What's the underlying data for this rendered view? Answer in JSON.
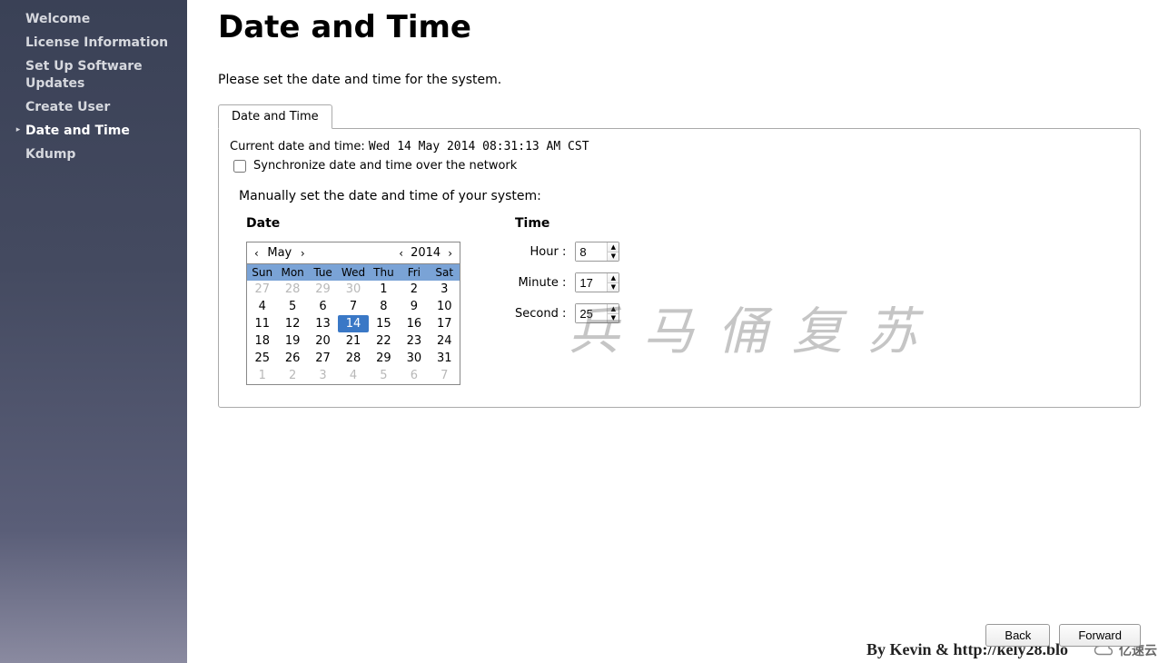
{
  "sidebar": {
    "items": [
      {
        "label": "Welcome",
        "current": false
      },
      {
        "label": "License Information",
        "current": false
      },
      {
        "label": "Set Up Software Updates",
        "current": false
      },
      {
        "label": "Create User",
        "current": false
      },
      {
        "label": "Date and Time",
        "current": true
      },
      {
        "label": "Kdump",
        "current": false
      }
    ]
  },
  "page": {
    "title": "Date and Time",
    "description": "Please set the date and time for the system."
  },
  "tab": {
    "label": "Date and Time"
  },
  "current_dt": {
    "label": "Current date and time:  ",
    "value": "Wed 14 May 2014 08:31:13 AM CST"
  },
  "sync": {
    "checked": false,
    "label": "Synchronize date and time over the network"
  },
  "manual": {
    "label": "Manually set the date and time of your system:"
  },
  "date": {
    "heading": "Date",
    "month": "May",
    "year": "2014",
    "dow": [
      "Sun",
      "Mon",
      "Tue",
      "Wed",
      "Thu",
      "Fri",
      "Sat"
    ],
    "grid": [
      {
        "n": "27",
        "m": true
      },
      {
        "n": "28",
        "m": true
      },
      {
        "n": "29",
        "m": true
      },
      {
        "n": "30",
        "m": true
      },
      {
        "n": "1"
      },
      {
        "n": "2"
      },
      {
        "n": "3"
      },
      {
        "n": "4"
      },
      {
        "n": "5"
      },
      {
        "n": "6"
      },
      {
        "n": "7"
      },
      {
        "n": "8"
      },
      {
        "n": "9"
      },
      {
        "n": "10"
      },
      {
        "n": "11"
      },
      {
        "n": "12"
      },
      {
        "n": "13"
      },
      {
        "n": "14",
        "sel": true
      },
      {
        "n": "15"
      },
      {
        "n": "16"
      },
      {
        "n": "17"
      },
      {
        "n": "18"
      },
      {
        "n": "19"
      },
      {
        "n": "20"
      },
      {
        "n": "21"
      },
      {
        "n": "22"
      },
      {
        "n": "23"
      },
      {
        "n": "24"
      },
      {
        "n": "25"
      },
      {
        "n": "26"
      },
      {
        "n": "27"
      },
      {
        "n": "28"
      },
      {
        "n": "29"
      },
      {
        "n": "30"
      },
      {
        "n": "31"
      },
      {
        "n": "1",
        "m": true
      },
      {
        "n": "2",
        "m": true
      },
      {
        "n": "3",
        "m": true
      },
      {
        "n": "4",
        "m": true
      },
      {
        "n": "5",
        "m": true
      },
      {
        "n": "6",
        "m": true
      },
      {
        "n": "7",
        "m": true
      }
    ]
  },
  "time": {
    "heading": "Time",
    "hour_label": "Hour :",
    "hour": "8",
    "minute_label": "Minute :",
    "minute": "17",
    "second_label": "Second :",
    "second": "25"
  },
  "buttons": {
    "back": "Back",
    "forward": "Forward"
  },
  "watermarks": {
    "cn": "兵马俑复苏",
    "en": "By Kevin & http://kely28.blo",
    "cloud": "亿速云"
  }
}
